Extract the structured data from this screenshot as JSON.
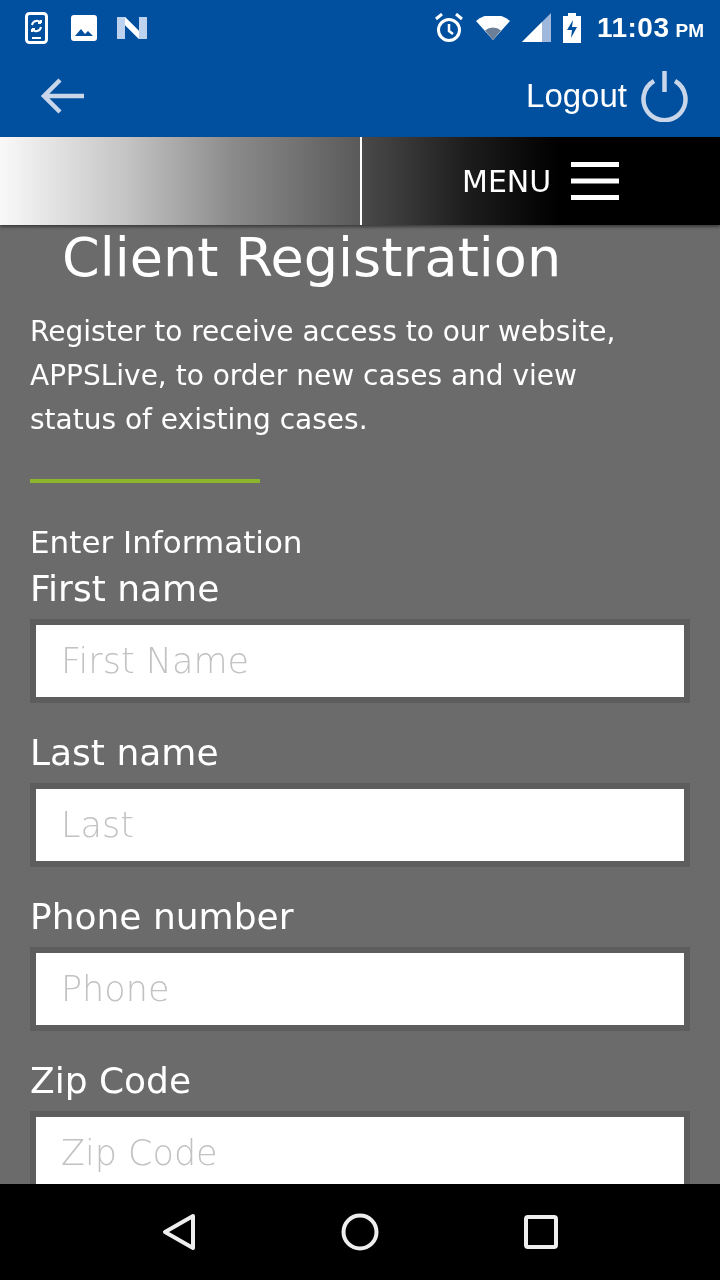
{
  "status_bar": {
    "time": "11:03",
    "period": "PM"
  },
  "app_bar": {
    "logout": "Logout"
  },
  "banner": {
    "menu": "MENU"
  },
  "title": "Client Registration",
  "intro": "Register to receive access to our website, APPSLive, to order new cases and view status of existing cases.",
  "section": "Enter Information",
  "fields": [
    {
      "label": "First name",
      "placeholder": "First Name"
    },
    {
      "label": "Last name",
      "placeholder": "Last"
    },
    {
      "label": "Phone number",
      "placeholder": "Phone"
    },
    {
      "label": "Zip Code",
      "placeholder": "Zip Code"
    }
  ]
}
